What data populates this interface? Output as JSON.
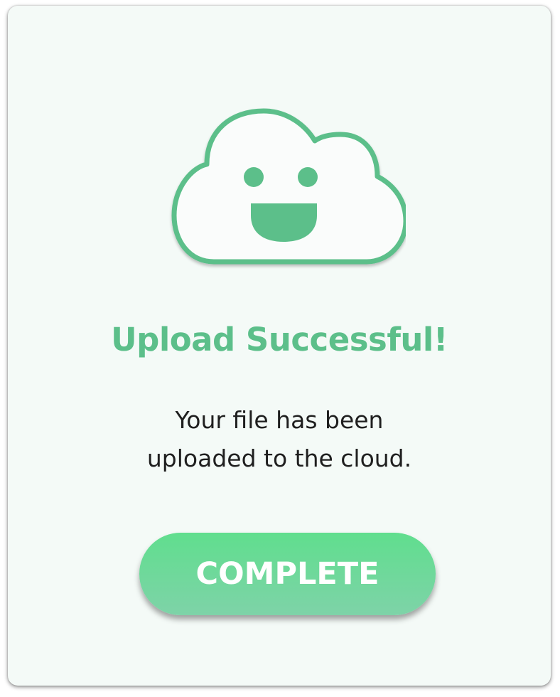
{
  "dialog": {
    "title": "Upload Successful!",
    "message_lines": [
      "Your file has been",
      "uploaded to the cloud."
    ],
    "button_label": "COMPLETE"
  },
  "icons": {
    "illustration": "smiling-cloud-icon"
  },
  "colors": {
    "accent": "#5cbf8a",
    "card_background": "#f4faf7",
    "button_gradient_top": "#60de8e",
    "button_gradient_bottom": "#7ed3a8",
    "text": "#1f1f1f",
    "button_text": "#ffffff"
  }
}
